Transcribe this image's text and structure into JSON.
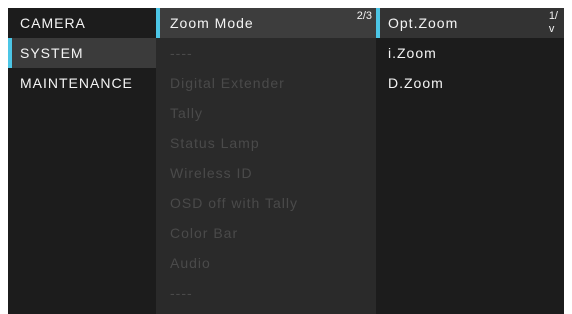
{
  "left_menu": {
    "items": [
      {
        "label": "CAMERA"
      },
      {
        "label": "SYSTEM"
      },
      {
        "label": "MAINTENANCE"
      }
    ]
  },
  "mid_menu": {
    "page": "2/3",
    "items": [
      {
        "label": "Zoom Mode"
      },
      {
        "label": "----"
      },
      {
        "label": "Digital Extender"
      },
      {
        "label": "Tally"
      },
      {
        "label": "Status Lamp"
      },
      {
        "label": "Wireless ID"
      },
      {
        "label": "OSD off with Tally"
      },
      {
        "label": "Color Bar"
      },
      {
        "label": "Audio"
      },
      {
        "label": "----"
      }
    ]
  },
  "right_menu": {
    "page": "1/",
    "page_arrow": "v",
    "items": [
      {
        "label": "Opt.Zoom"
      },
      {
        "label": "i.Zoom"
      },
      {
        "label": "D.Zoom"
      }
    ]
  },
  "colors": {
    "accent": "#4cc6e6",
    "text": "#f4f4f4",
    "dim_text": "#4a4a4a"
  }
}
